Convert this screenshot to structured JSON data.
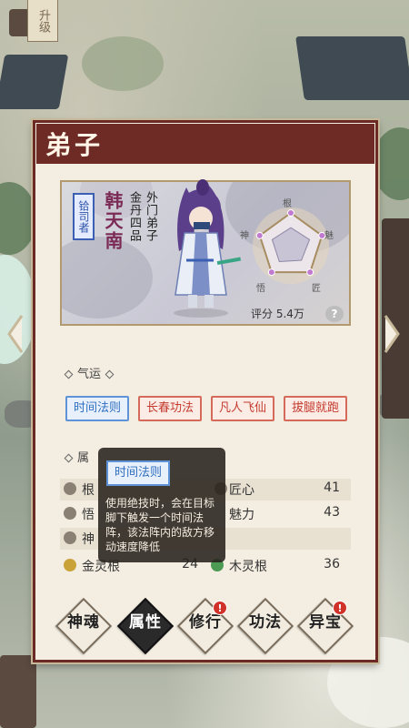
{
  "upgrade_tag": "升级",
  "panel": {
    "title": "弟子"
  },
  "hero": {
    "rank_seal": "铪司者",
    "name": "韩天南",
    "realm": "金丹四品",
    "sect_rank": "外门弟子",
    "score": "评分 5.4万",
    "help": "?"
  },
  "radar": {
    "labels": {
      "top": "根",
      "right": "魅",
      "bottom_right": "匠",
      "bottom_left": "悟",
      "left": "神"
    },
    "values": {
      "top": 0.55,
      "right": 0.6,
      "bottom_right": 0.55,
      "bottom_left": 0.6,
      "left": 0.6
    }
  },
  "fortune": {
    "heading": "气运",
    "tags": [
      {
        "label": "时间法则",
        "color": "blue"
      },
      {
        "label": "长春功法",
        "color": "red"
      },
      {
        "label": "凡人飞仙",
        "color": "red"
      },
      {
        "label": "拔腿就跑",
        "color": "red"
      }
    ]
  },
  "attributes": {
    "heading": "属",
    "rows": [
      {
        "left_label": "根",
        "left_value": "",
        "right_label": "匠心",
        "right_value": "41"
      },
      {
        "left_label": "悟",
        "left_value": "",
        "right_label": "魅力",
        "right_value": "43"
      },
      {
        "left_label": "神",
        "left_value": "",
        "right_label": "",
        "right_value": ""
      },
      {
        "left_label": "金灵根",
        "left_value": "24",
        "right_label": "木灵根",
        "right_value": "36"
      }
    ]
  },
  "tooltip": {
    "title": "时间法则",
    "text": "使用绝技时，会在目标脚下触发一个时间法阵，该法阵内的敌方移动速度降低"
  },
  "nav": [
    {
      "label": "神魂",
      "active": false,
      "badge": false
    },
    {
      "label": "属性",
      "active": true,
      "badge": false
    },
    {
      "label": "修行",
      "active": false,
      "badge": true
    },
    {
      "label": "功法",
      "active": false,
      "badge": false
    },
    {
      "label": "异宝",
      "active": false,
      "badge": true
    }
  ],
  "badge_text": "!",
  "colors": {
    "title_bar": "#6e2b25",
    "panel_bg": "#f4eee2",
    "tag_blue": "#2f6ec0",
    "tag_red": "#c43a2e",
    "badge": "#d0322a"
  }
}
